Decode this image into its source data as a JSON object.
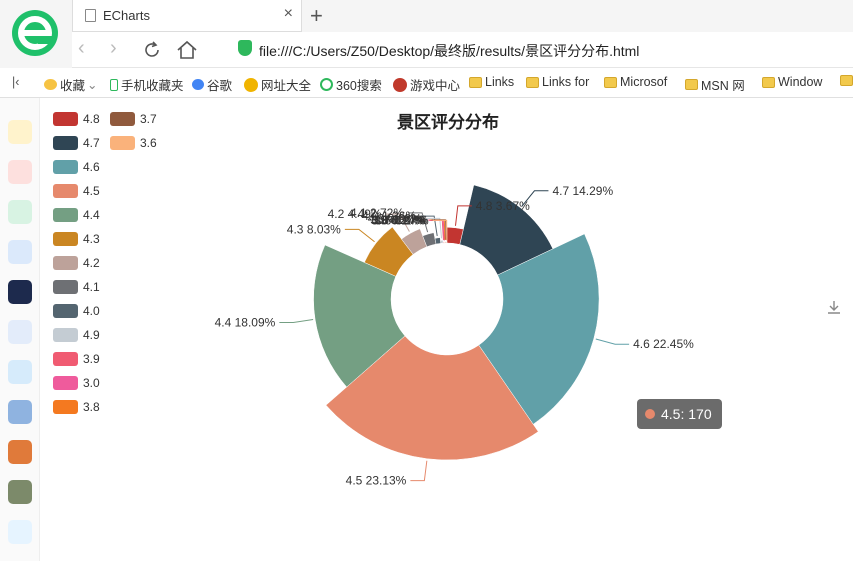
{
  "browser": {
    "tab_title": "ECharts",
    "url": "file:///C:/Users/Z50/Desktop/最终版/results/景区评分分布.html",
    "bookmarks": [
      "收藏",
      "手机收藏夹",
      "谷歌",
      "网址大全",
      "360搜索",
      "游戏中心",
      "Links",
      "Links for",
      "Microsof",
      "MSN 网",
      "Window"
    ]
  },
  "tooltip": {
    "text": "4.5: 170",
    "color": "#e6896c"
  },
  "chart_data": {
    "type": "pie",
    "roseType": "radius",
    "title": "景区评分分布",
    "legend_position": "top-left",
    "slices": [
      {
        "name": "4.8",
        "percent": "3.67%",
        "value": 27,
        "color": "#c23531"
      },
      {
        "name": "4.7",
        "percent": "14.29%",
        "value": 105,
        "color": "#2f4554"
      },
      {
        "name": "4.6",
        "percent": "22.45%",
        "value": 165,
        "color": "#61a0a8"
      },
      {
        "name": "4.5",
        "percent": "23.13%",
        "value": 170,
        "color": "#e6896c"
      },
      {
        "name": "4.4",
        "percent": "18.09%",
        "value": 133,
        "color": "#749f83"
      },
      {
        "name": "4.3",
        "percent": "8.03%",
        "value": 59,
        "color": "#ca8622"
      },
      {
        "name": "4.2",
        "percent": "4.49%",
        "value": 33,
        "color": "#bda29a"
      },
      {
        "name": "4.1",
        "percent": "2.72%",
        "value": 20,
        "color": "#6e7074"
      },
      {
        "name": "4.0",
        "percent": "1.36%",
        "value": 10,
        "color": "#546570"
      },
      {
        "name": "4.9",
        "percent": "0.68%",
        "value": 5,
        "color": "#c4ccd3"
      },
      {
        "name": "3.9",
        "percent": "0.27%",
        "value": 2,
        "color": "#f05b72"
      },
      {
        "name": "3.0",
        "percent": "0.14%",
        "value": 1,
        "color": "#ef5b9c"
      },
      {
        "name": "3.8",
        "percent": "0.27%",
        "value": 2,
        "color": "#f47920"
      },
      {
        "name": "3.7",
        "percent": "0.27%",
        "value": 2,
        "color": "#905a3d"
      },
      {
        "name": "3.6",
        "percent": "0.14%",
        "value": 1,
        "color": "#fab27b"
      }
    ]
  }
}
